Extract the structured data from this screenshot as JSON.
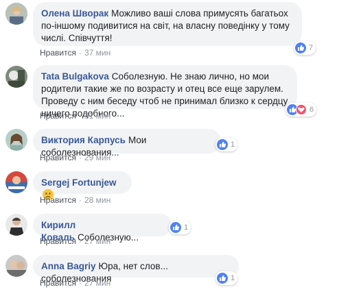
{
  "like_label": "Нравится",
  "separator": "·",
  "comments": [
    {
      "author": "Олена Шворак",
      "text": "Можливо ваші слова примусять багатьох по-іншому подивитися на світ, на власну поведінку у тому числі. Співчуття!",
      "time": "37 мин",
      "reactions": [
        "like"
      ],
      "reaction_count": "7"
    },
    {
      "author": "Tata Bulgakova",
      "text": "Соболезную. Не знаю лично, но мои родители такие же по возрасту и отец все еще зарулем. Проведу с ним беседу чтоб не принимал близко к сердцу ничего подобного...",
      "time": "31 мин",
      "reactions": [
        "like",
        "love"
      ],
      "reaction_count": "6"
    },
    {
      "author": "Виктория Карпусь",
      "text": "Мои соболезнования...",
      "time": "29 мин",
      "reactions": [
        "like"
      ],
      "reaction_count": "1"
    },
    {
      "author": "Sergej Fortunjew",
      "text": "",
      "emoji": "sad-face",
      "time": "28 мин",
      "reactions": [],
      "reaction_count": ""
    },
    {
      "author": "Кирилл Коваль",
      "text": "Соболезную...",
      "time": "27 мин",
      "reactions": [
        "like"
      ],
      "reaction_count": "1"
    },
    {
      "author": "Anna Bagriy",
      "text": "Юра, нет слов... соболезнования",
      "time": "27 мин",
      "reactions": [
        "like"
      ],
      "reaction_count": "1"
    }
  ],
  "colors": {
    "author": "#385898",
    "bubble": "#f2f3f5",
    "meta": "#90949c",
    "like": "#4f81f7",
    "love": "#f25268"
  }
}
